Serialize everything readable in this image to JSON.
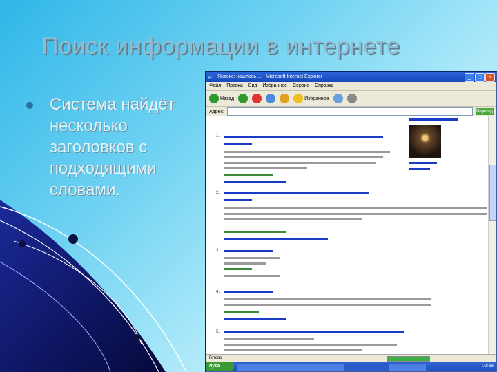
{
  "slide": {
    "title": "Поиск информации в интернете",
    "bullet": "Система найдёт несколько заголовков с подходящими словами."
  },
  "browser": {
    "window_title": "Яндекс: нашлось ... - Microsoft Internet Explorer",
    "menu": [
      "Файл",
      "Правка",
      "Вид",
      "Избранное",
      "Сервис",
      "Справка"
    ],
    "toolbar": {
      "back_label": "Назад",
      "favorites_label": "Избранное"
    },
    "address_label": "Адрес:",
    "go_label": "Переход",
    "status_text": "Готово",
    "taskbar": {
      "start_label": "пуск",
      "time": "10:38"
    }
  },
  "colors": {
    "link": "#1a3ac8",
    "titlebar": "#2a64d8",
    "start": "#3b9a35"
  }
}
